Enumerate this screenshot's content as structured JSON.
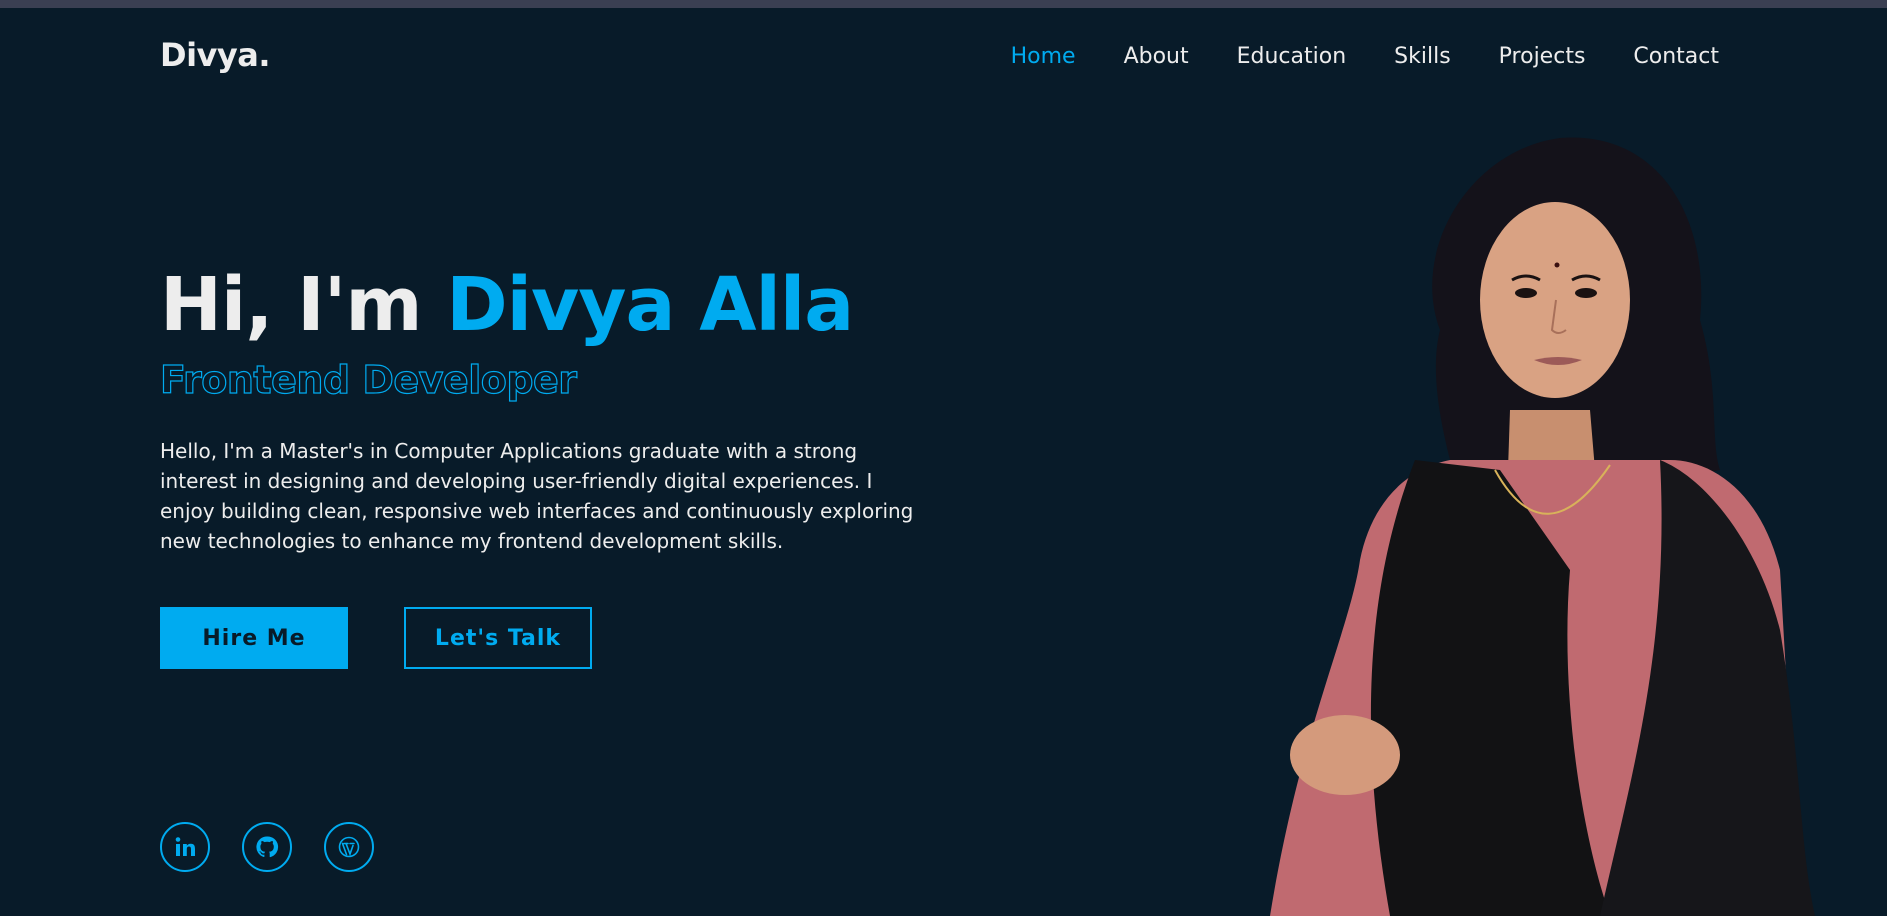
{
  "header": {
    "logo": "Divya.",
    "nav": [
      {
        "label": "Home",
        "active": true
      },
      {
        "label": "About"
      },
      {
        "label": "Education"
      },
      {
        "label": "Skills"
      },
      {
        "label": "Projects"
      },
      {
        "label": "Contact"
      }
    ]
  },
  "hero": {
    "greeting": "Hi, I'm ",
    "name": "Divya Alla",
    "role": "Frontend Developer",
    "description": "Hello, I'm a Master's in Computer Applications graduate with a strong interest in designing and developing user-friendly digital experiences. I enjoy building clean, responsive web interfaces and continuously exploring new technologies to enhance my frontend development skills.",
    "buttons": {
      "hire": "Hire Me",
      "talk": "Let's Talk"
    }
  },
  "socials": [
    {
      "icon": "linkedin-icon"
    },
    {
      "icon": "github-icon"
    },
    {
      "icon": "wordpress-icon"
    }
  ],
  "colors": {
    "background": "#081b29",
    "accent": "#00abf0",
    "text": "#ededed"
  }
}
